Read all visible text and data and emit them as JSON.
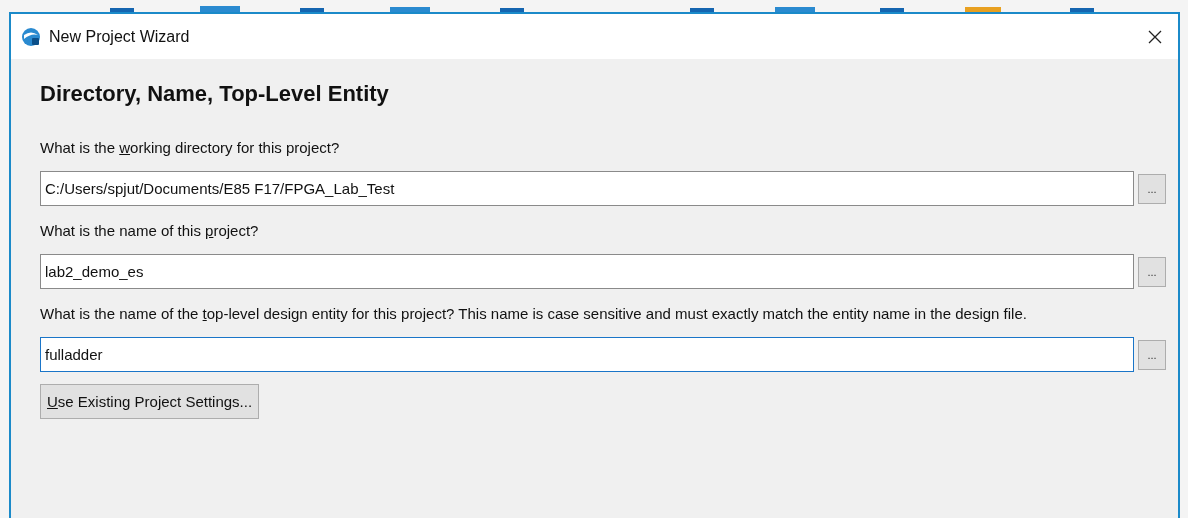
{
  "window": {
    "title": "New Project Wizard"
  },
  "heading": "Directory, Name, Top-Level Entity",
  "fields": [
    {
      "label": [
        "What is the ",
        "w",
        "orking directory for this project?"
      ],
      "value": "C:/Users/spjut/Documents/E85 F17/FPGA_Lab_Test",
      "focused": false,
      "browse": "..."
    },
    {
      "label": [
        "What is the name of this ",
        "p",
        "roject?"
      ],
      "value": "lab2_demo_es",
      "focused": false,
      "browse": "..."
    },
    {
      "label": [
        "What is the name of the ",
        "t",
        "op-level design entity for this project? This name is case sensitive and must exactly match the entity name in the design file."
      ],
      "value": "fulladder",
      "focused": true,
      "browse": "..."
    }
  ],
  "button": [
    "U",
    "se Existing Project Settings..."
  ]
}
